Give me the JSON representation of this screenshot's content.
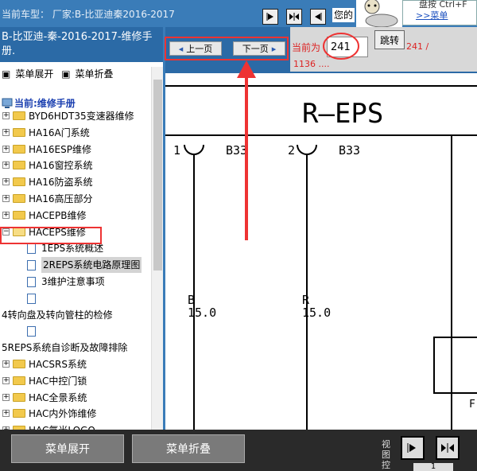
{
  "topbar": {
    "current_model": "当前车型： 厂家:B-比亚迪秦2016-2017",
    "yours_label": "您的",
    "hint_line1": "盘按 Ctrl+F",
    "hint_line2": ">>菜单"
  },
  "left": {
    "book_title": "B-比亚迪-秦-2016-2017-维修手册.",
    "expand_link": "菜单展开",
    "collapse_link": "菜单折叠",
    "current_label": "当前:维修手册",
    "tree": [
      {
        "label": "BYD6HDT35变速器维修",
        "type": "folder"
      },
      {
        "label": "HA16A门系统",
        "type": "folder"
      },
      {
        "label": "HA16ESP维修",
        "type": "folder"
      },
      {
        "label": "HA16窗控系统",
        "type": "folder"
      },
      {
        "label": "HA16防盗系统",
        "type": "folder"
      },
      {
        "label": "HA16高压部分",
        "type": "folder"
      },
      {
        "label": "HACEPB维修",
        "type": "folder"
      },
      {
        "label": "HACEPS维修",
        "type": "folder-open"
      },
      {
        "label": "1EPS系统概述",
        "type": "doc"
      },
      {
        "label": "2REPS系统电路原理图",
        "type": "doc-selected"
      },
      {
        "label": "3维护注意事项",
        "type": "doc"
      },
      {
        "label": "",
        "type": "doc"
      },
      {
        "label": "4转向盘及转向管柱的检修",
        "type": "text"
      },
      {
        "label": "",
        "type": "doc"
      },
      {
        "label": "5REPS系统自诊断及故障排除",
        "type": "text"
      },
      {
        "label": "HACSRS系统",
        "type": "folder"
      },
      {
        "label": "HAC中控门锁",
        "type": "folder"
      },
      {
        "label": "HAC全景系统",
        "type": "folder"
      },
      {
        "label": "HAC内外饰维修",
        "type": "folder"
      },
      {
        "label": "HAC氛光LOGO",
        "type": "folder"
      }
    ]
  },
  "right": {
    "prev_page": "上一页",
    "next_page": "下一页",
    "current_label": "当前为",
    "page_value": "241",
    "jump_label": "跳转",
    "total_line1": "241 /",
    "total_line2": "1136 ....",
    "schematic": {
      "title": "R—EPS",
      "pin1": "1",
      "pin2": "2",
      "conn1": "B33",
      "conn2": "B33",
      "wire1_color": "B",
      "wire1_size": "15.0",
      "wire2_color": "R",
      "wire2_size": "15.0",
      "corner_mark": "F"
    }
  },
  "bottom": {
    "expand_button": "菜单展开",
    "collapse_button": "菜单折叠",
    "view_label": "视图控",
    "view_page": "1"
  },
  "colors": {
    "accent_blue": "#2b6aa6",
    "highlight_red": "#e33333"
  }
}
